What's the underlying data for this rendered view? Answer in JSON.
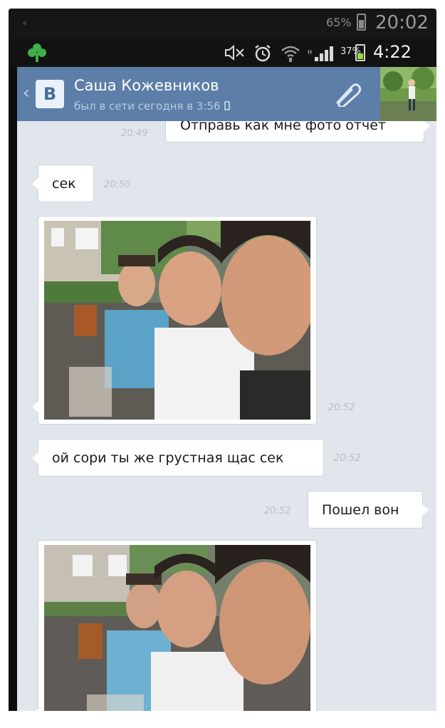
{
  "status_outer": {
    "battery": "65%",
    "time": "20:02"
  },
  "status_inner": {
    "battery": "37%",
    "time": "4:22"
  },
  "header": {
    "logo": "В",
    "contact_name": "Саша Кожевников",
    "last_seen": "был в сети сегодня в 3:56"
  },
  "messages": [
    {
      "id": "m1",
      "direction": "out",
      "text": "Отправь как мне фото отчет",
      "time": "20:49"
    },
    {
      "id": "m2",
      "direction": "in",
      "text": "сек",
      "time": "20:50"
    },
    {
      "id": "m3",
      "direction": "in",
      "type": "photo",
      "time": "20:52"
    },
    {
      "id": "m4",
      "direction": "in",
      "text": "ой сори ты же грустная щас сек",
      "time": "20:52"
    },
    {
      "id": "m5",
      "direction": "out",
      "text": "Пошел вон",
      "time": "20:52"
    },
    {
      "id": "m6",
      "direction": "in",
      "type": "photo"
    }
  ],
  "colors": {
    "header_bg": "#5c7ea8",
    "chat_bg": "#e1e6ed",
    "bubble_bg": "#ffffff",
    "time_color": "#b9bec6"
  },
  "icons": [
    "clover-icon",
    "mute-icon",
    "alarm-icon",
    "wifi-icon",
    "signal-icon",
    "battery-icon",
    "back-icon",
    "vk-logo",
    "paperclip-icon",
    "phone-icon"
  ]
}
